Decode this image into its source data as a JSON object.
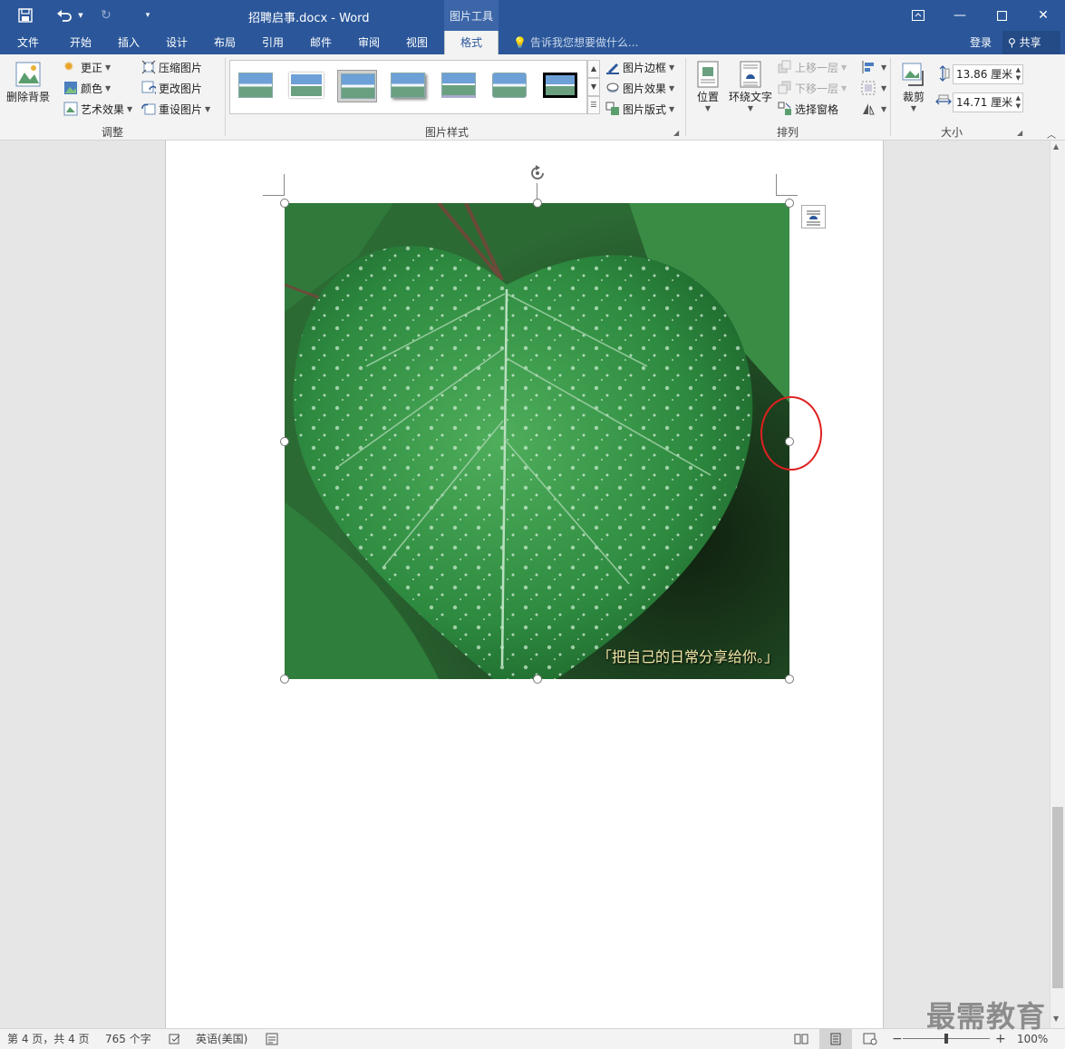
{
  "titlebar": {
    "doc_title": "招聘启事.docx - Word",
    "context_tab": "图片工具"
  },
  "tabs": [
    "文件",
    "开始",
    "插入",
    "设计",
    "布局",
    "引用",
    "邮件",
    "审阅",
    "视图",
    "格式"
  ],
  "active_tab": "格式",
  "tell_me": "告诉我您想要做什么...",
  "account": {
    "login": "登录",
    "share": "共享"
  },
  "ribbon": {
    "adjust": {
      "remove_bg": "删除背景",
      "corrections": "更正",
      "color": "颜色",
      "artistic": "艺术效果",
      "compress": "压缩图片",
      "change": "更改图片",
      "reset": "重设图片",
      "label": "调整"
    },
    "styles": {
      "border": "图片边框",
      "effects": "图片效果",
      "layout": "图片版式",
      "label": "图片样式"
    },
    "arrange": {
      "position": "位置",
      "wrap_text": "环绕文字",
      "bring_forward": "上移一层",
      "send_backward": "下移一层",
      "selection_pane": "选择窗格",
      "label": "排列"
    },
    "size": {
      "crop": "裁剪",
      "height": "13.86 厘米",
      "width": "14.71 厘米",
      "label": "大小"
    }
  },
  "document": {
    "image_caption": "「把自己的日常分享给你。」"
  },
  "statusbar": {
    "page": "第 4 页，共 4 页",
    "words": "765 个字",
    "language": "英语(美国)",
    "zoom": "100%"
  },
  "watermark": "最需教育",
  "colors": {
    "accent": "#2b579a",
    "highlight": "#e02020"
  }
}
